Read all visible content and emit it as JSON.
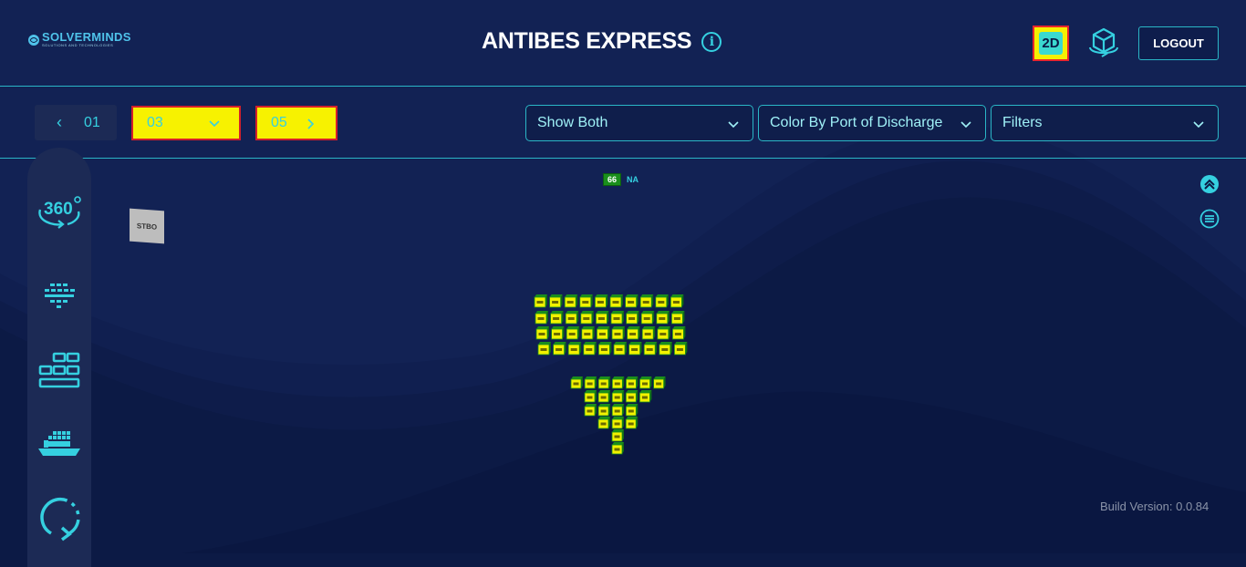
{
  "header": {
    "logo_text": "SOLVERMINDS",
    "logo_subtext": "SOLUTIONS AND TECHNOLOGIES",
    "vessel_name": "ANTIBES EXPRESS",
    "view_2d_label": "2D",
    "logout_label": "LOGOUT"
  },
  "toolbar": {
    "bay_current": "01",
    "bay_select_1": "03",
    "bay_select_2": "05",
    "show_dropdown": "Show Both",
    "color_dropdown": "Color By Port of Discharge",
    "filters_dropdown": "Filters"
  },
  "sidebar": {
    "items": [
      "360-view-icon",
      "cargo-layout-icon",
      "stack-blocks-icon",
      "vessel-icon",
      "refresh-icon"
    ]
  },
  "viewer": {
    "tier_tag": "66",
    "tier_status": "NA",
    "port_marker": "STBO"
  },
  "footer": {
    "build_version": "Build Version: 0.0.84"
  },
  "colors": {
    "background": "#0c1a45",
    "accent": "#35d0e0",
    "highlight": "#f7f200",
    "container": "#f2f200",
    "container_edge": "#1a8f1c"
  }
}
